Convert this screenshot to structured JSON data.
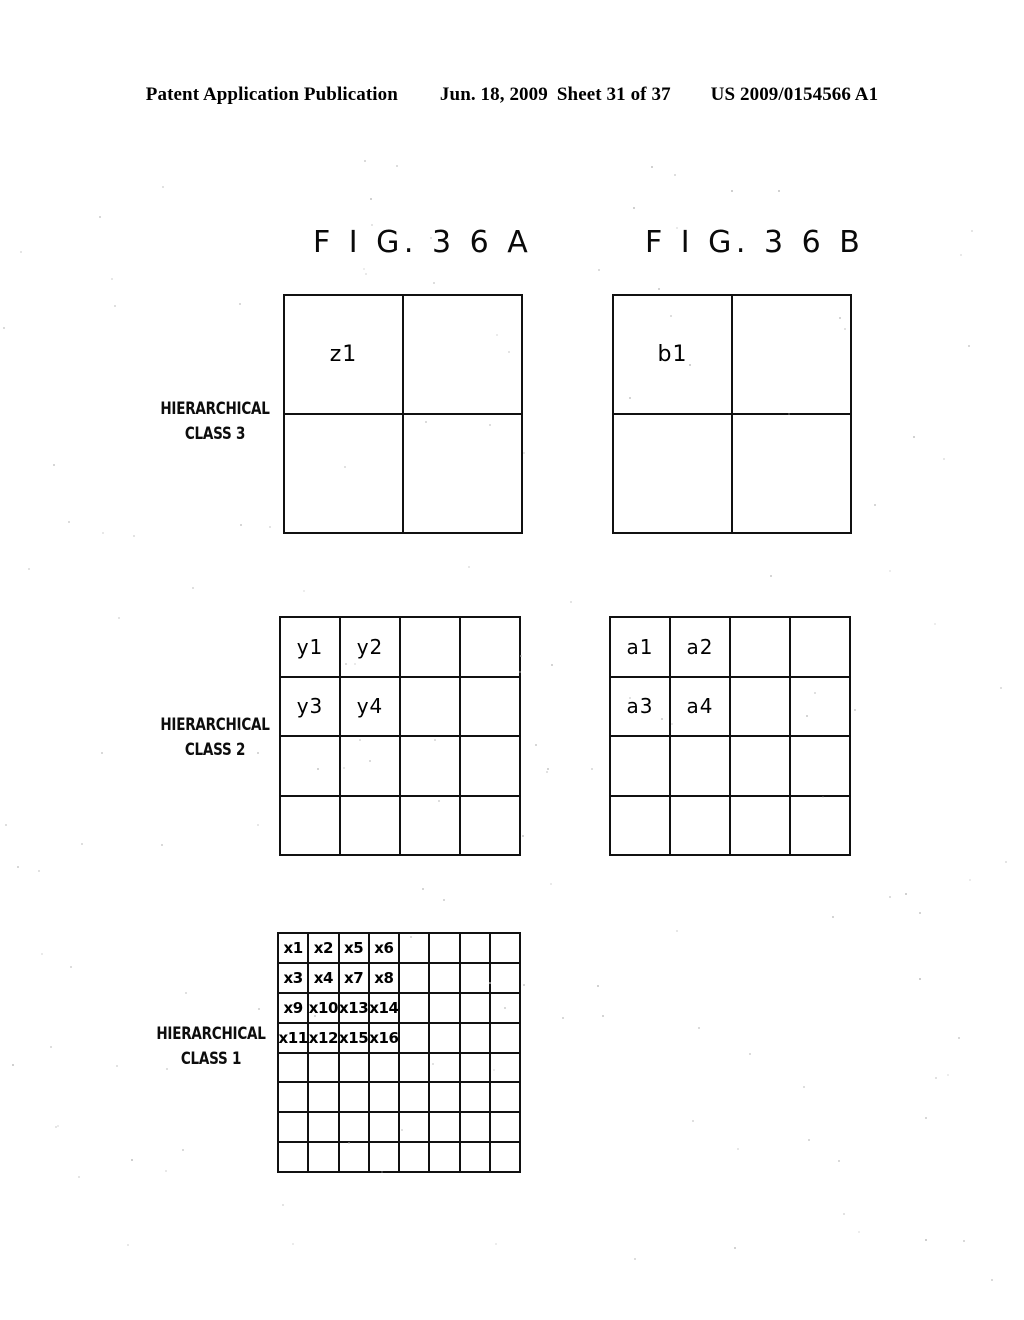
{
  "header": {
    "publication": "Patent Application Publication",
    "date": "Jun. 18, 2009",
    "sheet": "Sheet 31 of 37",
    "patent_number": "US 2009/0154566 A1"
  },
  "figures": {
    "a": {
      "title": "F I G.  3 6 A"
    },
    "b": {
      "title": "F I G.  3 6 B"
    }
  },
  "row_labels": {
    "class3": "HIERARCHICAL\nCLASS 3",
    "class3_line1": "HIERARCHICAL",
    "class3_line2": "CLASS 3",
    "class2_line1": "HIERARCHICAL",
    "class2_line2": "CLASS 2",
    "class1_line1": "HIERARCHICAL",
    "class1_line2": "CLASS 1"
  },
  "colors": {
    "ink": "#000000",
    "grid_line": "#111111",
    "paper": "#ffffff"
  },
  "grids": {
    "a_class3": {
      "rows": 2,
      "cols": 2,
      "cells": [
        [
          "z1",
          "",
          ""
        ],
        [
          "",
          ""
        ]
      ],
      "flat": [
        "z1",
        "",
        "",
        ""
      ]
    },
    "b_class3": {
      "rows": 2,
      "cols": 2,
      "flat": [
        "b1",
        "",
        "",
        ""
      ]
    },
    "a_class2": {
      "rows": 4,
      "cols": 4,
      "flat": [
        "y1",
        "y2",
        "",
        "",
        "y3",
        "y4",
        "",
        "",
        "",
        "",
        "",
        "",
        "",
        "",
        "",
        ""
      ]
    },
    "b_class2": {
      "rows": 4,
      "cols": 4,
      "flat": [
        "a1",
        "a2",
        "",
        "",
        "a3",
        "a4",
        "",
        "",
        "",
        "",
        "",
        "",
        "",
        "",
        "",
        ""
      ]
    },
    "a_class1": {
      "rows": 8,
      "cols": 8,
      "flat": [
        "x1",
        "x2",
        "x5",
        "x6",
        "",
        "",
        "",
        "",
        "x3",
        "x4",
        "x7",
        "x8",
        "",
        "",
        "",
        "",
        "x9",
        "x10",
        "x13",
        "x14",
        "",
        "",
        "",
        "",
        "x11",
        "x12",
        "x15",
        "x16",
        "",
        "",
        "",
        "",
        "",
        "",
        "",
        "",
        "",
        "",
        "",
        "",
        "",
        "",
        "",
        "",
        "",
        "",
        "",
        "",
        "",
        "",
        "",
        "",
        "",
        "",
        "",
        "",
        "",
        "",
        "",
        "",
        "",
        "",
        "",
        ""
      ]
    }
  }
}
